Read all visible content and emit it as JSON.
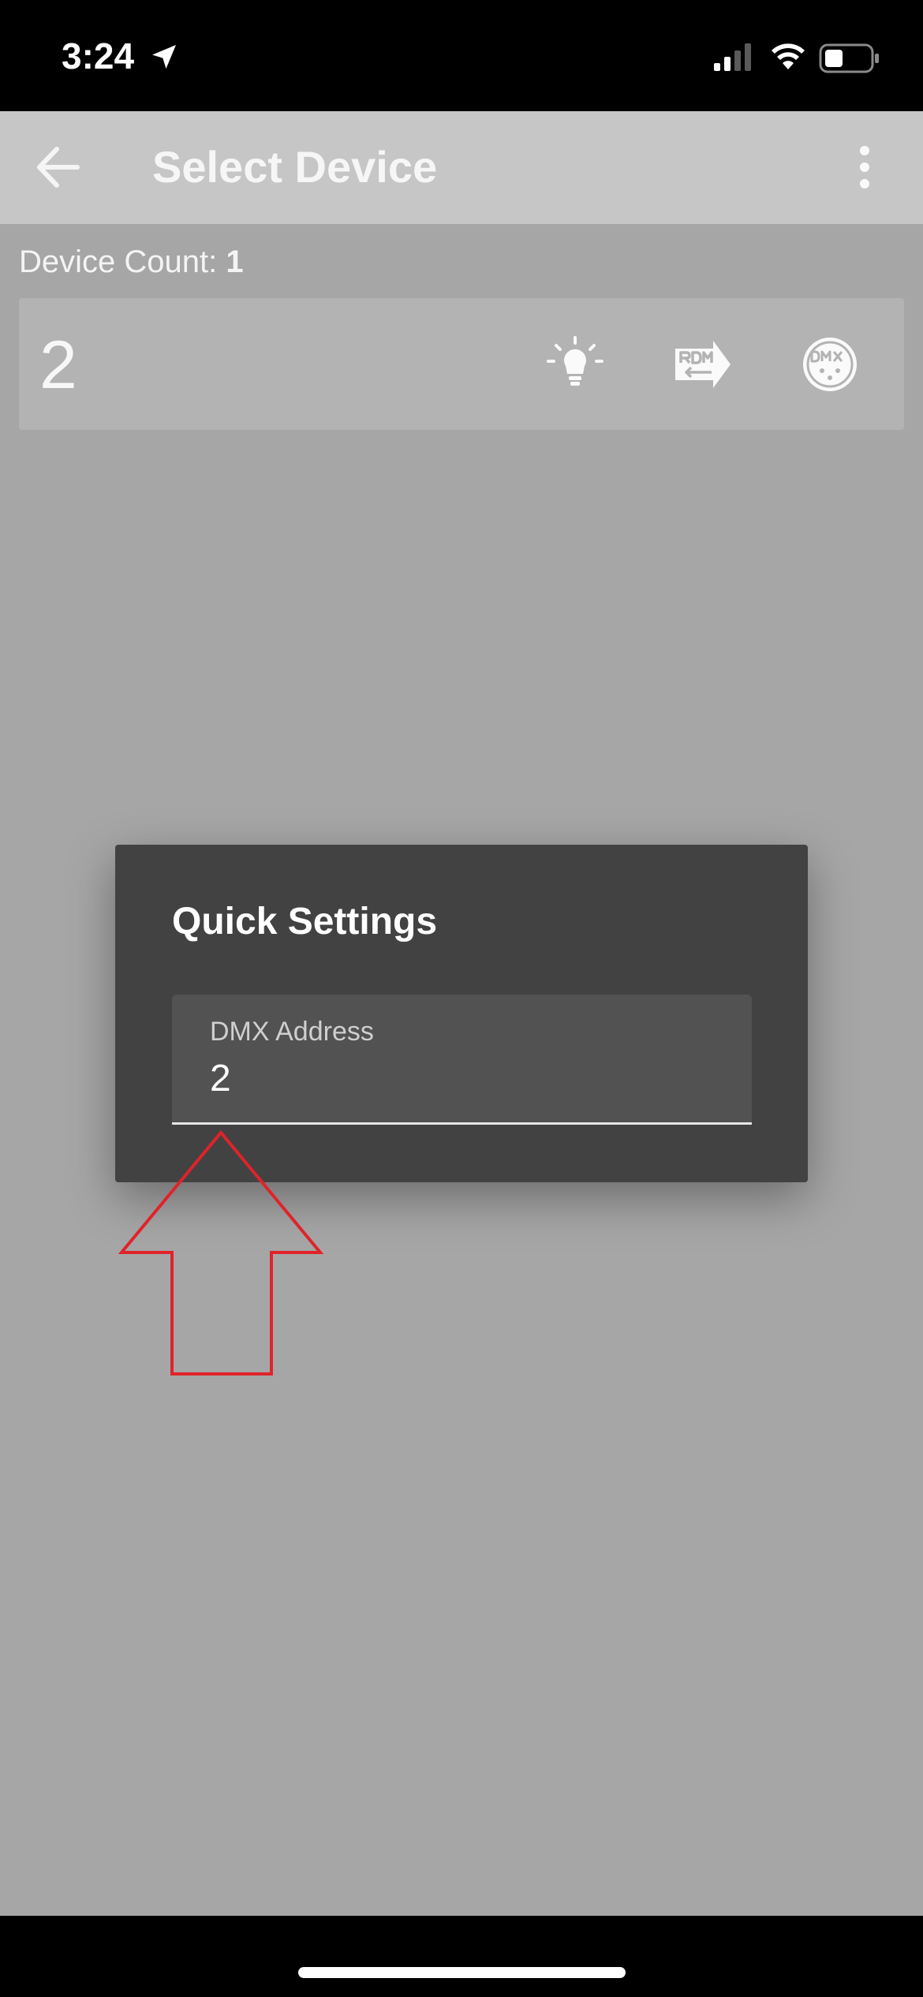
{
  "status_bar": {
    "time": "3:24"
  },
  "app_bar": {
    "title": "Select Device"
  },
  "device_list": {
    "count_label": "Device Count:",
    "count_value": "1",
    "devices": [
      {
        "name": "2",
        "actions": [
          "bulb-icon",
          "rdm-icon",
          "dmx-icon"
        ]
      }
    ]
  },
  "dialog": {
    "title": "Quick Settings",
    "dmx_field": {
      "label": "DMX Address",
      "value": "2"
    }
  },
  "colors": {
    "annotation_arrow": "#e0232a",
    "dialog_bg": "#424242",
    "app_bar_bg": "#c6c6c6"
  }
}
